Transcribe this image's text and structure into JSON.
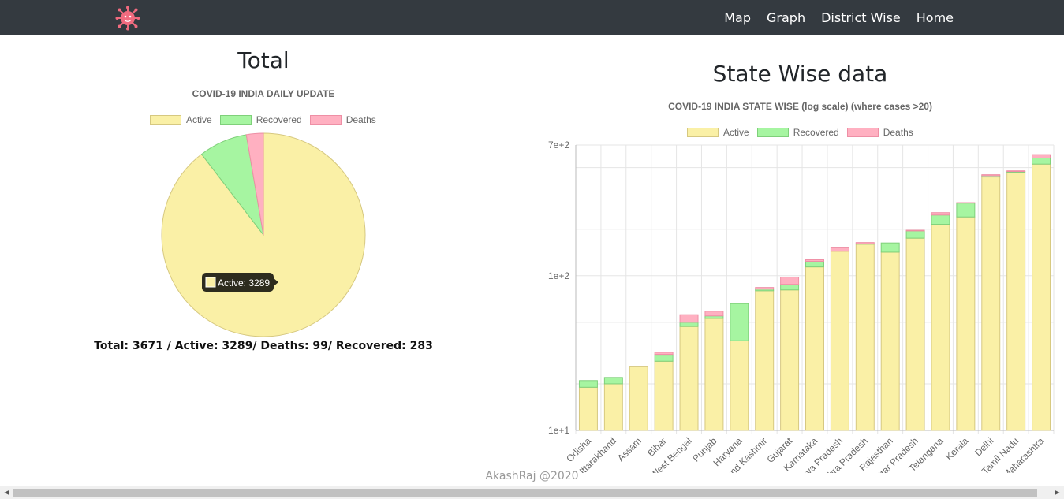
{
  "nav": {
    "logo_icon": "virus-icon",
    "links": [
      "Map",
      "Graph",
      "District Wise",
      "Home"
    ]
  },
  "total_section": {
    "title": "Total",
    "summary": "Total: 3671 / Active: 3289/ Deaths: 99/ Recovered: 283",
    "tooltip": "Active: 3289"
  },
  "state_section": {
    "title": "State Wise data"
  },
  "footer": "AkashRaj @2020",
  "colors": {
    "active": "#faf0a6",
    "recovered": "#a6f5a1",
    "deaths": "#ffb0c1",
    "navbar": "#343a40"
  },
  "chart_data": [
    {
      "type": "pie",
      "title": "COVID-19 INDIA DAILY UPDATE",
      "legend": [
        "Active",
        "Recovered",
        "Deaths"
      ],
      "legend_position": "top",
      "categories": [
        "Active",
        "Recovered",
        "Deaths"
      ],
      "values": [
        3289,
        283,
        99
      ]
    },
    {
      "type": "bar",
      "stacked": true,
      "title": "COVID-19 INDIA STATE WISE (log scale) (where cases >20)",
      "legend": [
        "Active",
        "Recovered",
        "Deaths"
      ],
      "legend_position": "top",
      "y_scale": "log",
      "y_ticks": [
        "1e+1",
        "1e+2",
        "7e+2"
      ],
      "ylim": [
        10,
        700
      ],
      "grid": true,
      "categories": [
        "Odisha",
        "Uttarakhand",
        "Assam",
        "Bihar",
        "West Bengal",
        "Punjab",
        "Haryana",
        "Jammu and Kashmir",
        "Gujarat",
        "Karnataka",
        "Madhya Pradesh",
        "Andhra Pradesh",
        "Rajasthan",
        "Uttar Pradesh",
        "Telangana",
        "Kerala",
        "Delhi",
        "Tamil Nadu",
        "Maharashtra"
      ],
      "series": [
        {
          "name": "Active",
          "values": [
            19,
            20,
            26,
            28,
            47,
            53,
            38,
            80,
            81,
            114,
            144,
            160,
            142,
            175,
            215,
            240,
            435,
            466,
            527
          ]
        },
        {
          "name": "Recovered",
          "values": [
            2,
            2,
            0,
            3,
            3,
            2,
            28,
            2,
            7,
            10,
            0,
            1,
            21,
            20,
            32,
            55,
            8,
            6,
            50
          ]
        },
        {
          "name": "Deaths",
          "values": [
            0,
            0,
            0,
            1,
            6,
            4,
            0,
            2,
            10,
            3,
            9,
            3,
            0,
            2,
            9,
            2,
            7,
            5,
            30
          ]
        }
      ]
    }
  ]
}
